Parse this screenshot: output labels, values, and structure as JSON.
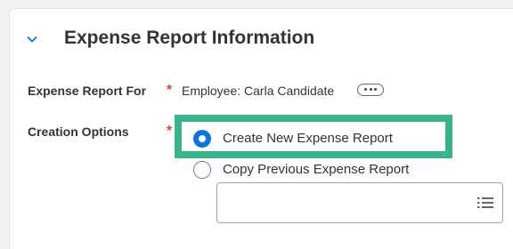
{
  "section": {
    "title": "Expense Report Information",
    "collapse_icon": "chevron-down-icon"
  },
  "fields": {
    "expense_report_for": {
      "label": "Expense Report For",
      "required_marker": "*",
      "value": "Employee: Carla Candidate",
      "related_actions_icon": "ellipsis-icon"
    },
    "creation_options": {
      "label": "Creation Options",
      "required_marker": "*",
      "options": [
        {
          "label": "Create New Expense Report",
          "selected": true
        },
        {
          "label": "Copy Previous Expense Report",
          "selected": false
        }
      ],
      "prompt_value": "",
      "prompt_icon": "list-icon"
    }
  },
  "colors": {
    "accent_blue": "#0875e1",
    "highlight_green": "#37b48a",
    "required_red": "#de4437",
    "text": "#333333"
  }
}
